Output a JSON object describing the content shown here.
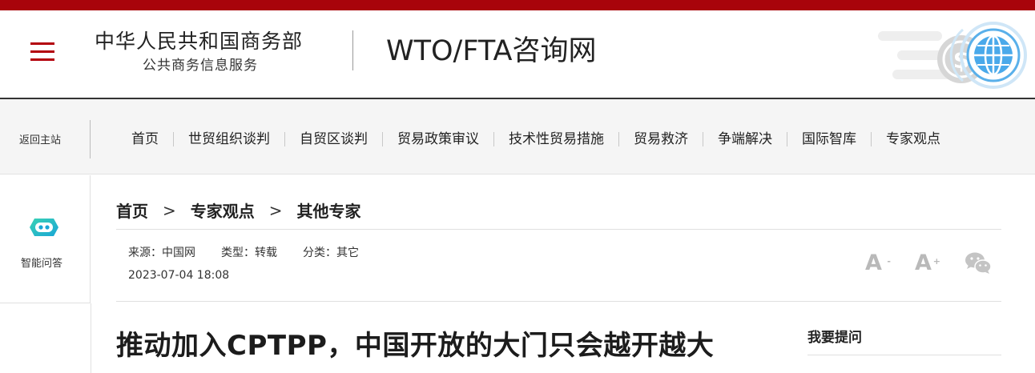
{
  "header": {
    "ministry_name": "中华人民共和国商务部",
    "ministry_sub": "公共商务信息服务",
    "site_title": "WTO/FTA咨询网",
    "brand_color": "#a8040b",
    "menu_icon": "hamburger-menu-icon",
    "decoration_icon": "dollar-globe-icon"
  },
  "nav": {
    "back_home": "返回主站",
    "items": [
      "首页",
      "世贸组织谈判",
      "自贸区谈判",
      "贸易政策审议",
      "技术性贸易措施",
      "贸易救济",
      "争端解决",
      "国际智库",
      "专家观点"
    ]
  },
  "sidebar": {
    "ai_label": "智能问答",
    "ai_icon": "chatbot-icon"
  },
  "breadcrumb": [
    "首页",
    "专家观点",
    "其他专家"
  ],
  "article": {
    "source": "来源：中国网",
    "type": "类型：转载",
    "category": "分类：其它",
    "date": "2023-07-04 18:08",
    "title": "推动加入CPTPP，中国开放的大门只会越开越大"
  },
  "tools": {
    "font_decrease": "A",
    "font_decrease_mark": "-",
    "font_increase": "A",
    "font_increase_mark": "+",
    "share_icon": "wechat-icon"
  },
  "aside": {
    "ask_title": "我要提问"
  }
}
